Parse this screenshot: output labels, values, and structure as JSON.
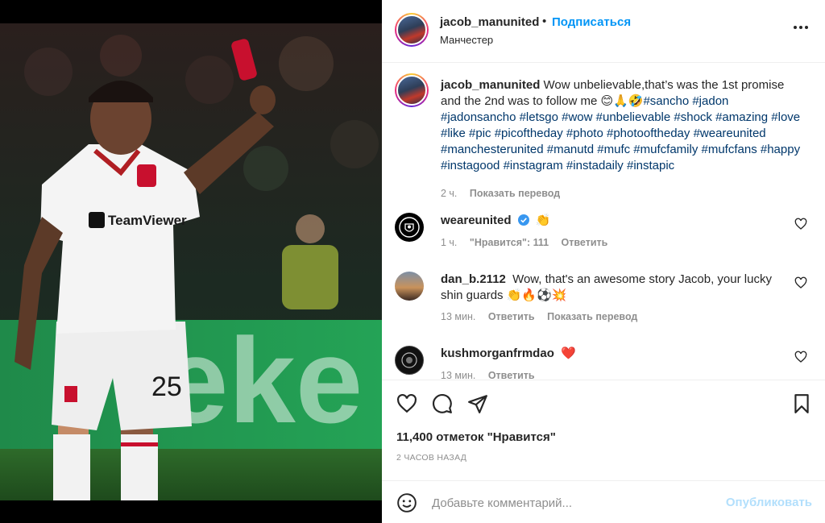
{
  "post": {
    "username": "jacob_manunited",
    "follow_label": "Подписаться",
    "location": "Манчестер",
    "photo_texts": {
      "sponsor": "TeamViewer",
      "shirt_number": "25",
      "board_text": "eke"
    }
  },
  "caption": {
    "username": "jacob_manunited",
    "text": "Wow unbelievable,that’s was the 1st promise and the 2nd was to follow me 😊🙏🤣",
    "hashtags": "#sancho #jadon #jadonsancho #letsgo #wow #unbelievable #shock #amazing #love #like #pic #picoftheday #photo #photooftheday #weareunited #manchesterunited #manutd #mufc #mufcfamily #mufcfans #happy #instagood #instagram #instadaily #instapic",
    "time": "2 ч.",
    "translate_label": "Показать перевод"
  },
  "comments": [
    {
      "username": "weareunited",
      "text": "👏",
      "time": "1 ч.",
      "likes_label": "\"Нравится\": 111",
      "reply_label": "Ответить"
    },
    {
      "username": "dan_b.2112",
      "text": "Wow, that's an awesome story Jacob, your lucky shin guards 👏🔥⚽💥",
      "time": "13 мин.",
      "reply_label": "Ответить",
      "translate_label": "Показать перевод"
    },
    {
      "username": "kushmorganfrmdao",
      "text": "❤️",
      "time": "13 мин.",
      "reply_label": "Ответить"
    }
  ],
  "stats": {
    "likes": "11,400 отметок \"Нравится\"",
    "time_ago": "2 ЧАСОВ НАЗАД"
  },
  "composer": {
    "placeholder": "Добавьте комментарий...",
    "post_label": "Опубликовать"
  },
  "colors": {
    "link_blue": "#0095f6",
    "hashtag": "#00376b",
    "muted": "#8e8e8e",
    "post_disabled": "#b2dffc",
    "verified": "#3897f0"
  }
}
